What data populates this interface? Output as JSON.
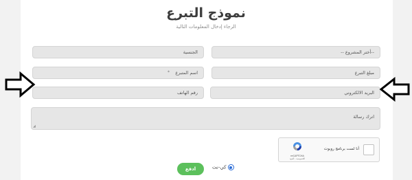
{
  "header": {
    "title": "نموذج التبرع",
    "subtitle": "الرجاء إدخال المعلومات التالية"
  },
  "fields": {
    "project": "--أختر المشروع --",
    "nationality": "الجنسية",
    "amount": "مبلغ التبرع",
    "donor_name": "اسم المتبرع",
    "email": "البريد الالكتروني",
    "phone": "رقم الهاتف",
    "message": "اترك رسالة"
  },
  "recaptcha": {
    "label": "أنا لست برنامج روبوت",
    "brand": "reCAPTCHA",
    "terms": "الخصوصية - البنود"
  },
  "payment": {
    "option_label": "كي-نت",
    "selected": true
  },
  "submit_label": "ادفع",
  "colors": {
    "submit": "#5cc05c",
    "field_bg": "#e6e6e6",
    "page_bg": "#f2f2f2"
  },
  "icons": {
    "left_pointer": "arrow-right-icon",
    "right_pointer": "arrow-left-icon"
  }
}
